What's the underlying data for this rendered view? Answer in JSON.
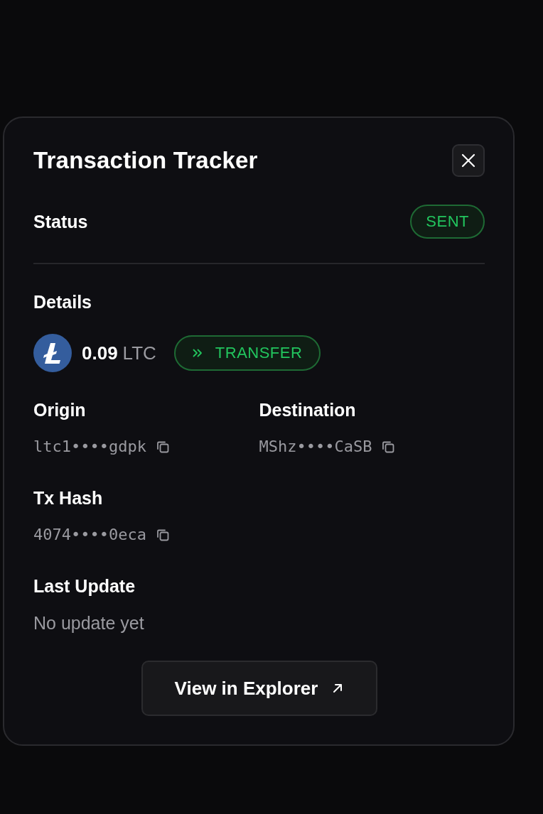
{
  "dialog": {
    "title": "Transaction Tracker"
  },
  "status": {
    "label": "Status",
    "badge": "SENT"
  },
  "details": {
    "heading": "Details",
    "amount": "0.09",
    "unit": "LTC",
    "type": "TRANSFER"
  },
  "rows": [
    [
      {
        "label": "Origin",
        "value": "ltc1••••gdpk",
        "kind": "address"
      },
      {
        "label": "Destination",
        "value": "MShz••••CaSB",
        "kind": "address"
      }
    ],
    [
      {
        "label": "Tx Hash",
        "value": "4074••••0eca",
        "kind": "address"
      }
    ],
    [
      {
        "label": "Last Update",
        "value": "No update yet",
        "kind": "text"
      }
    ]
  ],
  "button": {
    "label": "View in Explorer"
  }
}
